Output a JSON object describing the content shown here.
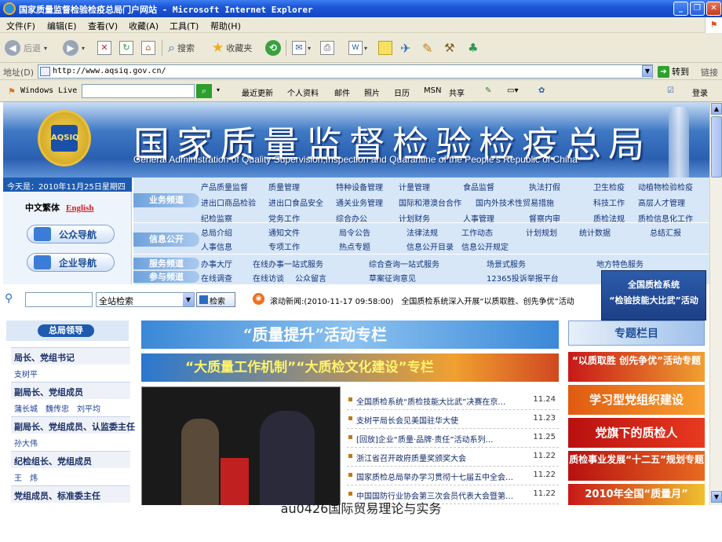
{
  "window": {
    "title": "国家质量监督检验检疫总局门户网站 - Microsoft Internet Explorer",
    "menu": [
      "文件(F)",
      "编辑(E)",
      "查看(V)",
      "收藏(A)",
      "工具(T)",
      "帮助(H)"
    ],
    "toolbar": {
      "back": "后退",
      "search": "搜索",
      "favorites": "收藏夹"
    },
    "address": {
      "label": "地址(D)",
      "url": "http://www.aqsiq.gov.cn/",
      "go": "转到",
      "links": "链接"
    },
    "livebar": {
      "brand": "Windows Live",
      "items": [
        "最近更新",
        "个人资料",
        "邮件",
        "照片",
        "日历",
        "MSN",
        "共享"
      ],
      "login": "登录"
    }
  },
  "banner": {
    "title": "国家质量监督检验检疫总局",
    "subtitle": "General Administration of Quality Supervision,Inspection and Quarantine of the People's Republic of China",
    "emblem": "AQSIQ"
  },
  "left_info": {
    "date": "今天是：2010年11月25日星期四",
    "lang_cn": "中文繁体",
    "lang_en": "English",
    "public_nav": "公众导航",
    "enterprise_nav": "企业导航"
  },
  "channels": {
    "business": {
      "label": "业务频道",
      "rows": [
        [
          "产品质量监督",
          "质量管理",
          "特种设备管理",
          "计量管理",
          "食品监督",
          "执法打假",
          "卫生检疫",
          "动植物检验检疫"
        ],
        [
          "进出口商品检验",
          "进出口食品安全",
          "通关业务管理",
          "国际和港澳台合作",
          "国内外技术性贸易措施",
          "科技工作",
          "高层人才管理"
        ],
        [
          "纪检监察",
          "党务工作",
          "综合办公",
          "计划财务",
          "人事管理",
          "督察内审",
          "质检法规",
          "质检信息化工作"
        ]
      ]
    },
    "info": {
      "label": "信息公开",
      "rows": [
        [
          "总局介绍",
          "通知文件",
          "局令公告",
          "法律法规",
          "工作动态",
          "计划规划",
          "统计数据",
          "总结汇报"
        ],
        [
          "人事信息",
          "专项工作",
          "热点专题",
          "信息公开目录",
          "信息公开规定"
        ]
      ]
    },
    "service": {
      "label1": "服务频道",
      "label2": "参与频道",
      "rows": [
        [
          "办事大厅",
          "在线办事一站式服务",
          "综合查询一站式服务",
          "场景式服务",
          "地方特色服务"
        ],
        [
          "在线调查",
          "在线访谈",
          "公众留言",
          "草案征询意见",
          "12365投诉举报平台"
        ]
      ]
    }
  },
  "search": {
    "scope": "全站检索",
    "button": "检索"
  },
  "rolling_news": "滚动新闻:(2010-11-17 09:58:00)　全国质检系统深入开展“以质取胜、创先争优”活动",
  "popup": {
    "line1": "全国质检系统",
    "line2": "“检验技能大比武”活动"
  },
  "leaders": {
    "header": "总局领导",
    "groups": [
      {
        "title": "局长、党组书记",
        "names": "支树平"
      },
      {
        "title": "副局长、党组成员",
        "names": "蒲长城　魏传忠　刘平均"
      },
      {
        "title": "副局长、党组成员、认监委主任",
        "names": "孙大伟"
      },
      {
        "title": "纪检组长、党组成员",
        "names": "王　炜"
      },
      {
        "title": "党组成员、标准委主任",
        "names": ""
      }
    ]
  },
  "center": {
    "banner1": "“质量提升”活动专栏",
    "banner2": "“大质量工作机制”“大质检文化建设”专栏",
    "news": [
      {
        "title": "全国质检系统“质检技能大比武”决赛在京…",
        "date": "11.24"
      },
      {
        "title": "支树平局长会见美国驻华大使",
        "date": "11.23"
      },
      {
        "title": "[回放]企业“质量·品牌·责任”活动系列…",
        "date": "11.25"
      },
      {
        "title": "浙江省召开政府质量奖颁奖大会",
        "date": "11.22"
      },
      {
        "title": "国家质检总局举办学习贯彻十七届五中全会…",
        "date": "11.22"
      },
      {
        "title": "中国国防行业协会第三次会员代表大会暨第…",
        "date": "11.22"
      }
    ]
  },
  "right": {
    "special": "专题栏目",
    "banners": [
      "“以质取胜 创先争优”活动专题",
      "学习型党组织建设",
      "党旗下的质检人",
      "质检事业发展“十二五”规划专题",
      "2010年全国“质量月”"
    ]
  },
  "caption": "au0426国际贸易理论与实务",
  "colors": {
    "title_blue": "#1c56d6",
    "banner_blue": "#2a5fb0",
    "nav_bg": "#d7e7f8",
    "red": "#c81818"
  }
}
